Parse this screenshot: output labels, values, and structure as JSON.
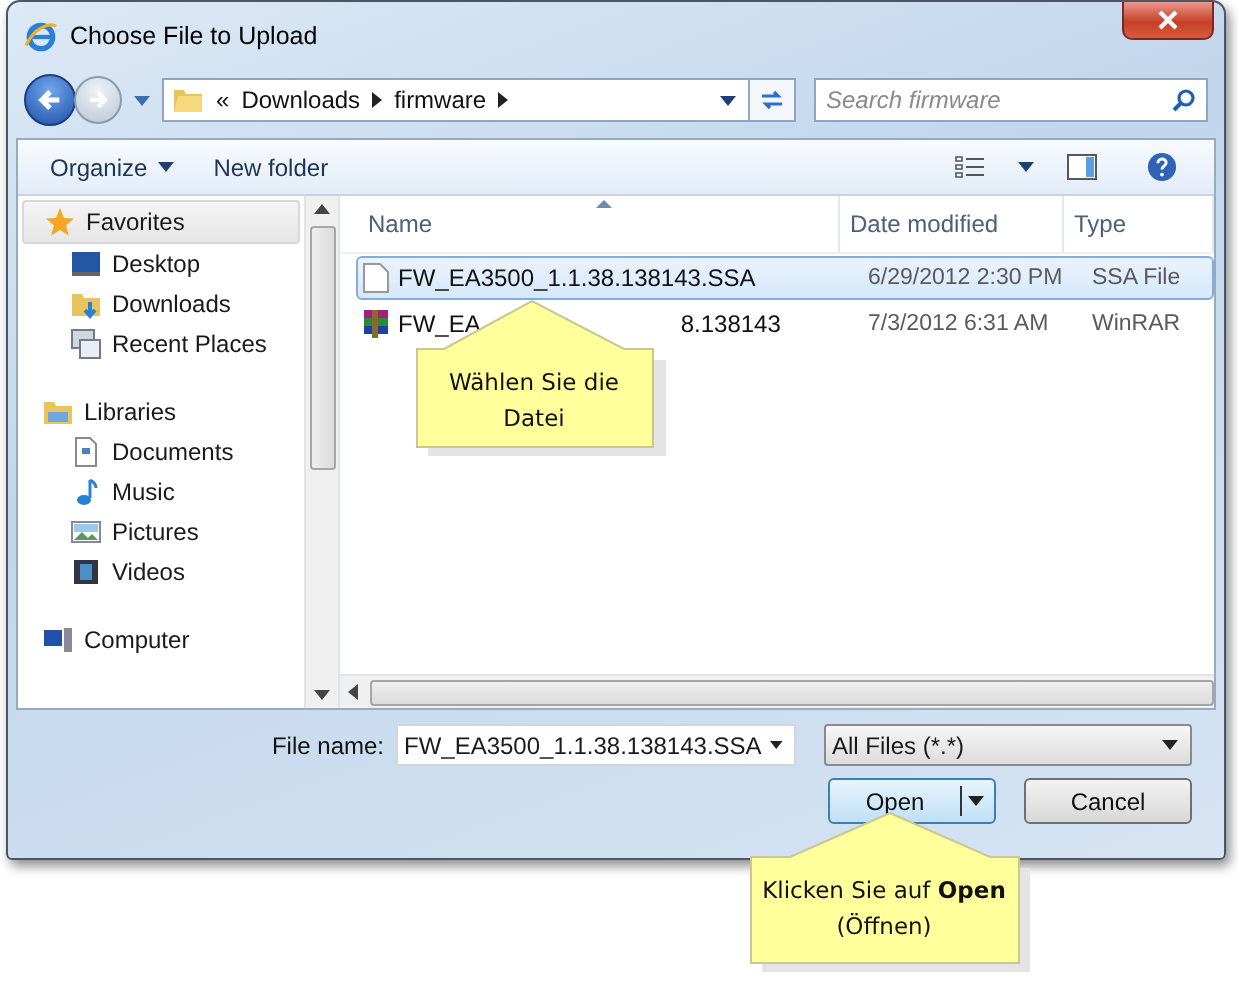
{
  "window": {
    "title": "Choose File to Upload"
  },
  "address": {
    "overflow": "«",
    "crumbs": [
      "Downloads",
      "firmware"
    ]
  },
  "search": {
    "placeholder": "Search firmware"
  },
  "toolbar": {
    "organize": "Organize",
    "new_folder": "New folder"
  },
  "sidebar": {
    "groups": [
      {
        "label": "Favorites",
        "selected": true,
        "children": [
          {
            "label": "Desktop",
            "selected": false
          },
          {
            "label": "Downloads",
            "selected": false
          },
          {
            "label": "Recent Places",
            "selected": false
          }
        ]
      },
      {
        "label": "Libraries",
        "selected": false,
        "children": [
          {
            "label": "Documents",
            "selected": false
          },
          {
            "label": "Music",
            "selected": false
          },
          {
            "label": "Pictures",
            "selected": false
          },
          {
            "label": "Videos",
            "selected": false
          }
        ]
      },
      {
        "label": "Computer",
        "selected": false
      }
    ]
  },
  "table": {
    "columns": [
      "Name",
      "Date modified",
      "Type"
    ],
    "rows": [
      {
        "kind": "file",
        "name_parts": [
          "FW_EA3500_1.1.38.138143.SSA"
        ],
        "date": "6/29/2012 2:30 PM",
        "type": "SSA File",
        "selected": true
      },
      {
        "kind": "archive",
        "name_parts": [
          "FW_EA",
          "8.138143"
        ],
        "date": "7/3/2012 6:31 AM",
        "type": "WinRAR",
        "selected": false
      }
    ]
  },
  "file_name": {
    "label": "File name:",
    "value": "FW_EA3500_1.1.38.138143.SSA"
  },
  "file_type": {
    "value": "All Files (*.*)"
  },
  "buttons": {
    "open": "Open",
    "cancel": "Cancel"
  },
  "callouts": [
    {
      "text": "Wählen Sie die Datei"
    },
    {
      "text": "Klicken Sie auf **Open** (Öffnen)"
    }
  ]
}
